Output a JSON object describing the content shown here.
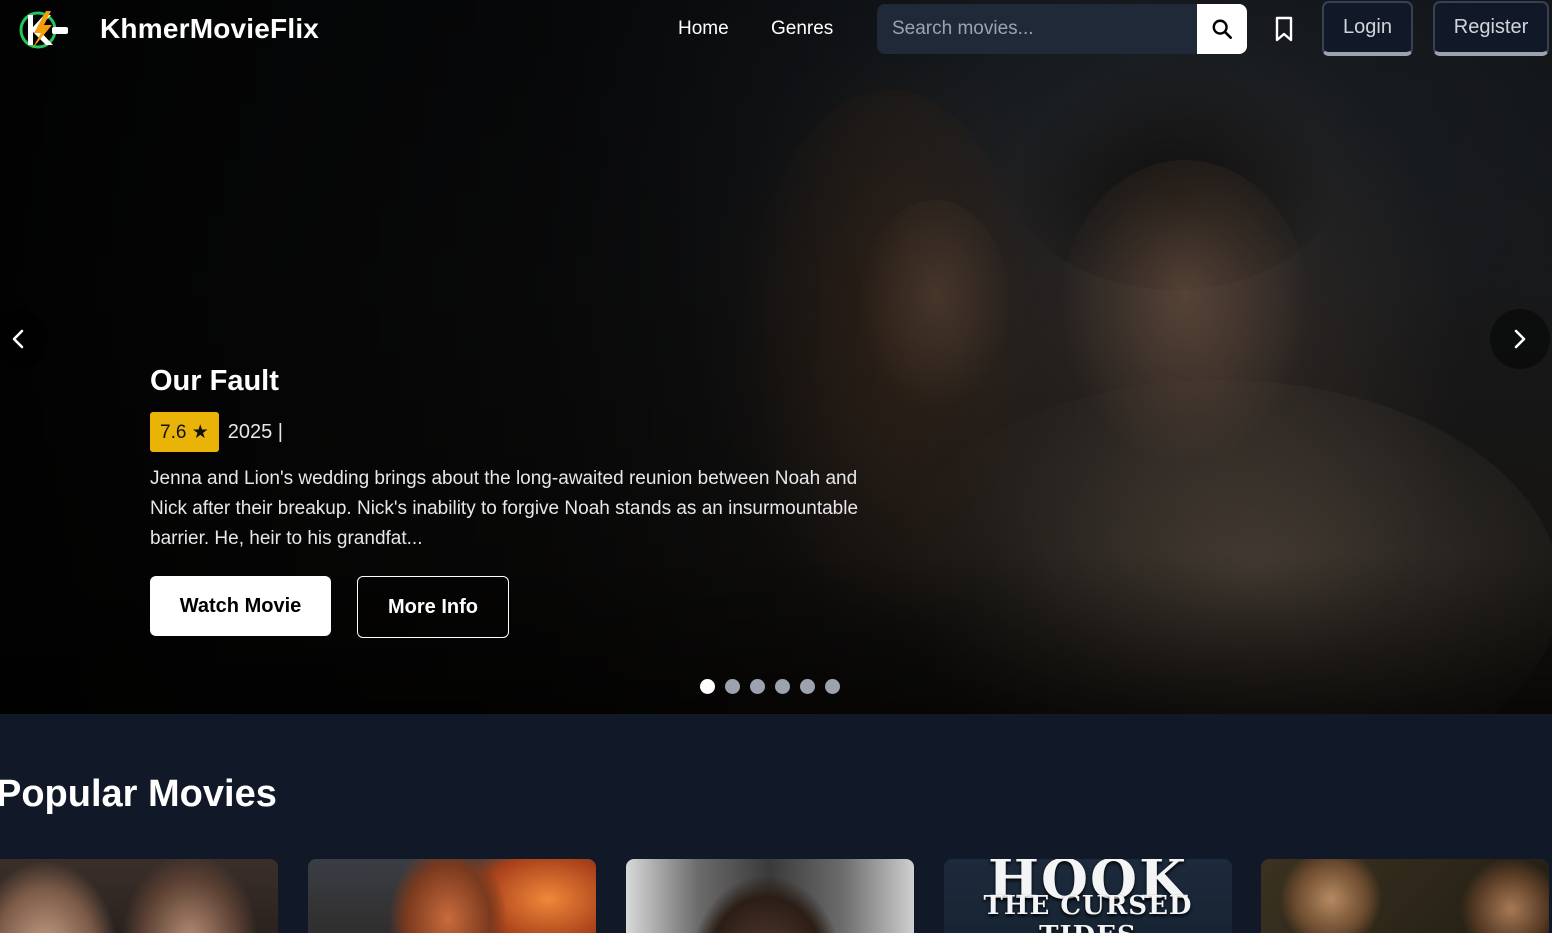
{
  "nav": {
    "brand": "KhmerMovieFlix",
    "links": [
      {
        "label": "Home"
      },
      {
        "label": "Genres"
      }
    ],
    "search_placeholder": "Search movies...",
    "login_label": "Login",
    "register_label": "Register",
    "icons": {
      "search": "search-icon",
      "bookmark": "bookmark-icon",
      "logo": "logo-icon"
    }
  },
  "hero": {
    "title": "Our Fault",
    "rating": "7.6 ★",
    "year": "2025 |",
    "description": "Jenna and Lion's wedding brings about the long-awaited reunion between Noah and Nick after their breakup. Nick's inability to forgive Noah stands as an insurmountable barrier. He, heir to his grandfat...",
    "watch_label": "Watch Movie",
    "info_label": "More Info",
    "slide_count": 6,
    "active_slide": 1
  },
  "popular": {
    "title": "Popular Movies",
    "cards": [
      {
        "poster_text": ""
      },
      {
        "poster_text": ""
      },
      {
        "poster_text": ""
      },
      {
        "poster_text": "HOOK",
        "poster_subtext": "THE CURSED TIDES"
      },
      {
        "poster_text": ""
      }
    ]
  },
  "colors": {
    "background": "#111827",
    "rating_badge": "#eab308",
    "search_field": "#1f2937"
  }
}
